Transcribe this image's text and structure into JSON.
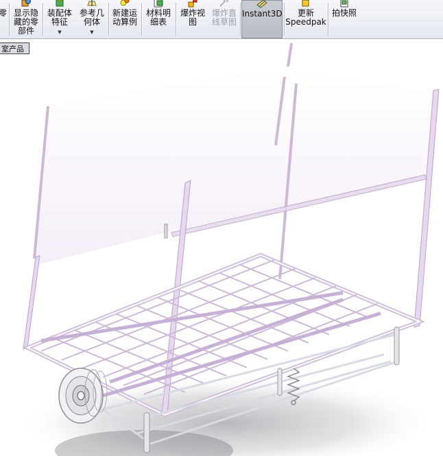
{
  "toolbar": {
    "partial_left_label": "零",
    "show_hidden": {
      "line1": "显示隐",
      "line2": "藏的零",
      "line3": "部件"
    },
    "assembly_feature": {
      "line1": "装配体",
      "line2": "特征",
      "arrow": "▼"
    },
    "reference_geometry": {
      "line1": "参考几",
      "line2": "何体",
      "arrow": "▼"
    },
    "new_motion_study": {
      "line1": "新建运",
      "line2": "动算例"
    },
    "bill_of_materials": {
      "line1": "材料明",
      "line2": "细表"
    },
    "exploded_view": {
      "line1": "爆炸视",
      "line2": "图"
    },
    "explode_line_sketch": {
      "line1": "爆炸直",
      "line2": "线草图"
    },
    "instant3d": {
      "label": "Instant3D"
    },
    "update_speedpak": {
      "line1": "更新",
      "line2": "Speedpak"
    },
    "snapshot": {
      "label": "拍快照"
    }
  },
  "config_tab": {
    "label": "室产品"
  },
  "colors": {
    "frame_edge": "#cdb8d8",
    "frame_face": "#f7f2fa",
    "toolbar_bg": "#e8ebf0",
    "active_button": "#bfc3ca"
  },
  "icons": {
    "show_hidden": "show-hidden-components-icon",
    "assembly_feature": "assembly-feature-icon",
    "reference_geometry": "reference-geometry-icon",
    "new_motion_study": "motion-study-icon",
    "bill_of_materials": "bill-of-materials-icon",
    "exploded_view": "exploded-view-icon",
    "explode_line_sketch": "explode-line-sketch-icon",
    "instant3d": "instant3d-icon",
    "update_speedpak": "speedpak-icon",
    "snapshot": "snapshot-icon"
  }
}
